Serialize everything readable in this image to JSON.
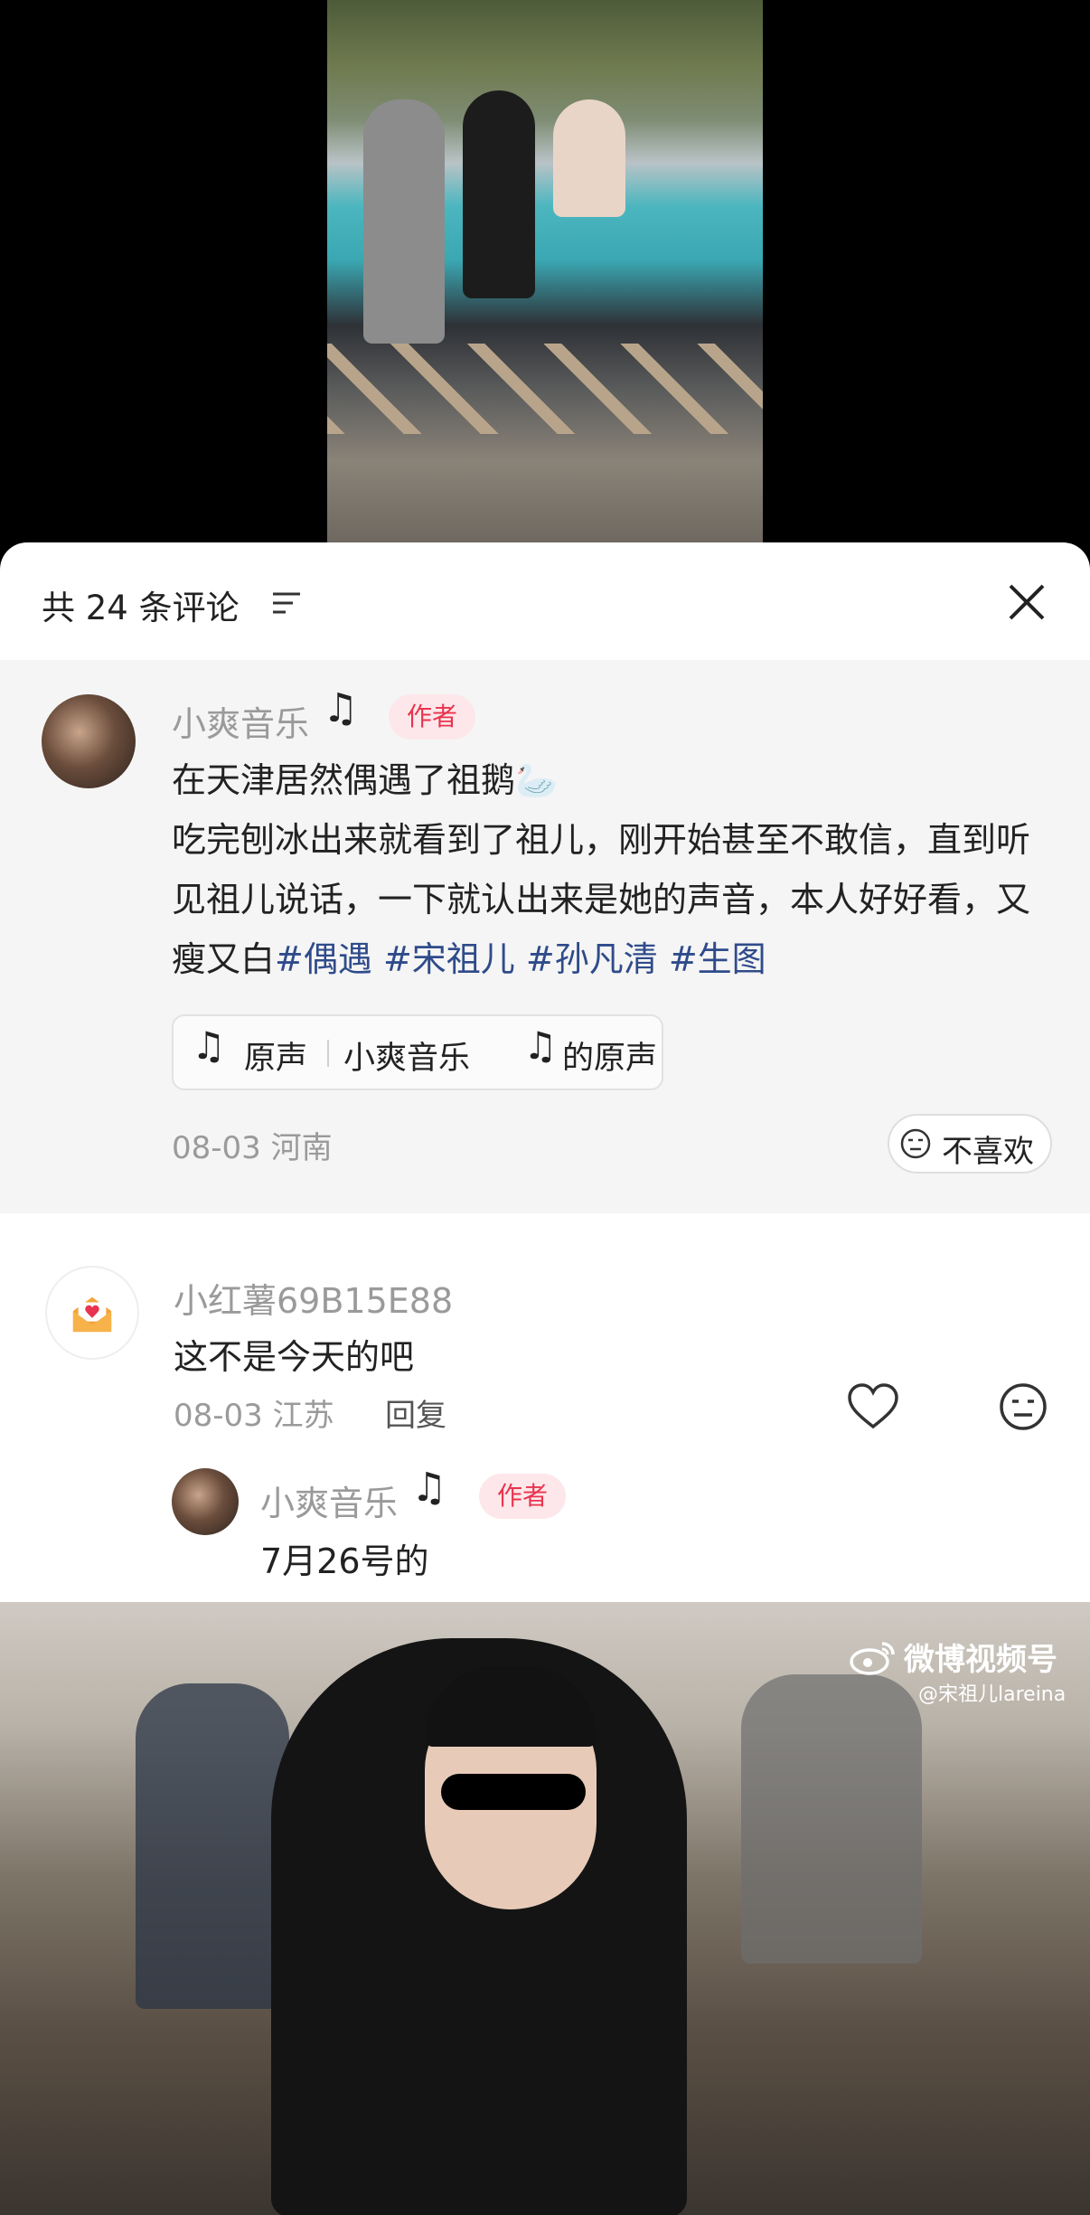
{
  "comments_header": {
    "count_label": "共 24 条评论"
  },
  "author_post": {
    "username": "小爽音乐",
    "badge": "作者",
    "text_line1": "在天津居然偶遇了祖鹅🦢",
    "text_body": "吃完刨冰出来就看到了祖儿，刚开始甚至不敢信，直到听见祖儿说话，一下就认出来是她的声音，本人好好看，又瘦又白",
    "hashtags": [
      "#偶遇",
      "#宋祖儿",
      "#孙凡清",
      "#生图"
    ],
    "sound": {
      "label": "原声",
      "name": "小爽音乐",
      "suffix": "的原声"
    },
    "meta": "08-03 河南",
    "dislike_label": "不喜欢"
  },
  "comments": [
    {
      "username": "小红薯69B15E88",
      "text": "这不是今天的吧",
      "meta": "08-03 江苏",
      "reply_label": "回复",
      "replies": [
        {
          "username": "小爽音乐",
          "badge": "作者",
          "text": "7月26号的"
        }
      ]
    }
  ],
  "video_watermark": {
    "title": "微博视频号",
    "handle": "@宋祖儿lareina"
  },
  "icons": {
    "music": "music-note-icon",
    "sort": "sort-icon",
    "close": "close-icon",
    "dislike": "neutral-face-icon",
    "like": "heart-outline-icon",
    "weibo": "weibo-logo-icon"
  },
  "colors": {
    "author_badge_bg": "#fde7ea",
    "author_badge_text": "#e8344e",
    "hashtag": "#2f4b8a",
    "muted_text": "#9a9a9a"
  }
}
